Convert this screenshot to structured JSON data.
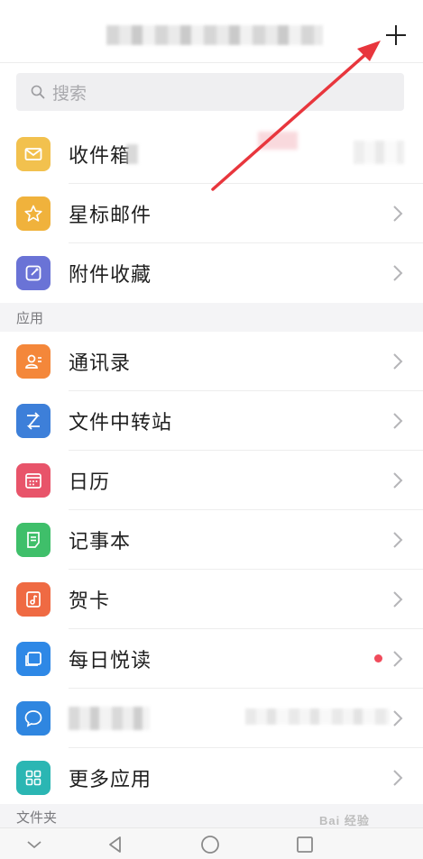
{
  "search": {
    "placeholder": "搜索"
  },
  "inbox": [
    {
      "label": "收件箱",
      "icon": "mail-icon",
      "color": "#f2c14e",
      "chevron": false
    },
    {
      "label": "星标邮件",
      "icon": "star-icon",
      "color": "#f0b23c",
      "chevron": true
    },
    {
      "label": "附件收藏",
      "icon": "attachment-icon",
      "color": "#6a73d6",
      "chevron": true
    }
  ],
  "sections": {
    "apps": "应用",
    "folders": "文件夹"
  },
  "apps": [
    {
      "label": "通讯录",
      "icon": "contacts-icon",
      "color": "#f4873a",
      "chevron": true,
      "badge": false
    },
    {
      "label": "文件中转站",
      "icon": "transfer-icon",
      "color": "#3d7fd9",
      "chevron": true,
      "badge": false
    },
    {
      "label": "日历",
      "icon": "calendar-icon",
      "color": "#e8546a",
      "chevron": true,
      "badge": false
    },
    {
      "label": "记事本",
      "icon": "notepad-icon",
      "color": "#3fbf6a",
      "chevron": true,
      "badge": false
    },
    {
      "label": "贺卡",
      "icon": "card-icon",
      "color": "#ef6a43",
      "chevron": true,
      "badge": false
    },
    {
      "label": "每日悦读",
      "icon": "reading-icon",
      "color": "#2e88e6",
      "chevron": true,
      "badge": true
    },
    {
      "label": "",
      "icon": "chat-icon",
      "color": "#2f86e0",
      "chevron": true,
      "badge": false,
      "redacted": true
    },
    {
      "label": "更多应用",
      "icon": "grid-icon",
      "color": "#2bb6b3",
      "chevron": true,
      "badge": false
    }
  ],
  "watermark": "Bai 经验",
  "colors": {
    "accent_arrow": "#e8363d",
    "separator": "#ededed",
    "section_bg": "#f4f4f6"
  }
}
